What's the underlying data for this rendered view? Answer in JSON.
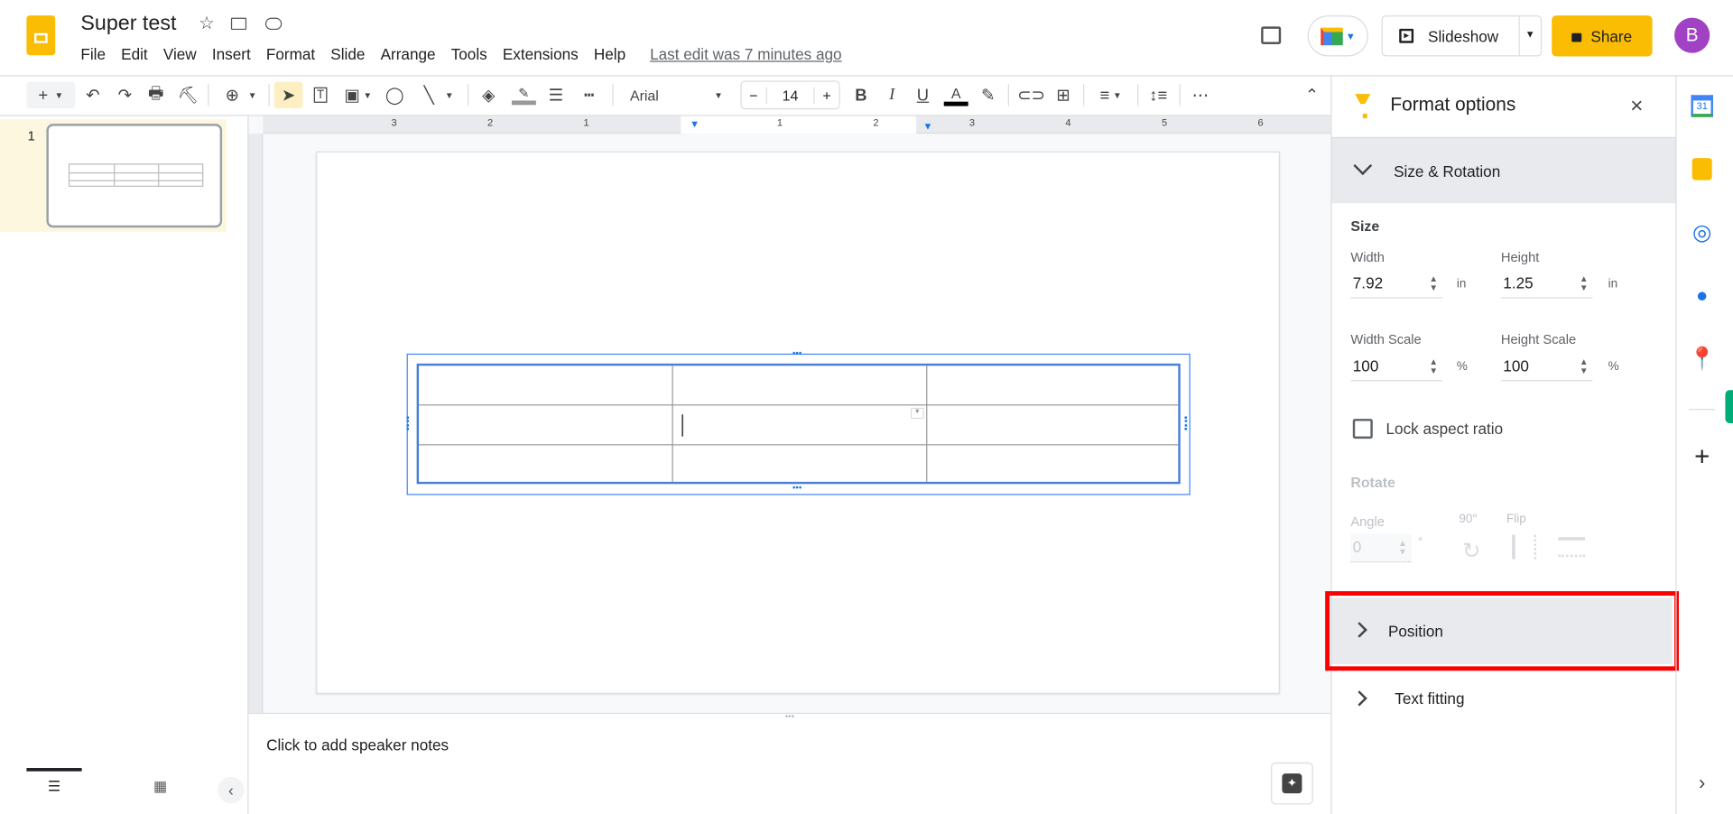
{
  "app": {
    "title": "Super test",
    "last_edit": "Last edit was 7 minutes ago",
    "menu": [
      "File",
      "Edit",
      "View",
      "Insert",
      "Format",
      "Slide",
      "Arrange",
      "Tools",
      "Extensions",
      "Help"
    ]
  },
  "header": {
    "slideshow_label": "Slideshow",
    "share_label": "Share",
    "avatar_letter": "B",
    "share_color": "#fbbc04",
    "avatar_color": "#a142c4"
  },
  "toolbar": {
    "font": "Arial",
    "font_size": "14",
    "text_color": "#000000"
  },
  "ruler": {
    "ticks": [
      "3",
      "2",
      "1",
      "1",
      "2",
      "3",
      "4",
      "5",
      "6"
    ]
  },
  "filmstrip": {
    "slides": [
      {
        "number": "1",
        "selected": true
      }
    ]
  },
  "notes": {
    "placeholder": "Click to add speaker notes"
  },
  "table": {
    "rows": 3,
    "cols": 3
  },
  "format_panel": {
    "title": "Format options",
    "size_rotation": {
      "label": "Size & Rotation",
      "expanded": true,
      "size_heading": "Size",
      "width_label": "Width",
      "width": "7.92",
      "width_unit": "in",
      "height_label": "Height",
      "height": "1.25",
      "height_unit": "in",
      "width_scale_label": "Width Scale",
      "width_scale": "100",
      "width_scale_unit": "%",
      "height_scale_label": "Height Scale",
      "height_scale": "100",
      "height_scale_unit": "%",
      "lock_label": "Lock aspect ratio",
      "lock_checked": false,
      "rotate_heading": "Rotate",
      "angle_label": "Angle",
      "angle": "0",
      "angle_unit": "°",
      "rotate90_label": "90°",
      "flip_label": "Flip"
    },
    "position": {
      "label": "Position",
      "expanded": false,
      "highlight_color": "#ff0000"
    },
    "text_fitting": {
      "label": "Text fitting",
      "expanded": false
    }
  },
  "side_apps": [
    "calendar-icon",
    "keep-icon",
    "tasks-icon",
    "contacts-icon",
    "maps-icon"
  ],
  "calendar_day": "31"
}
